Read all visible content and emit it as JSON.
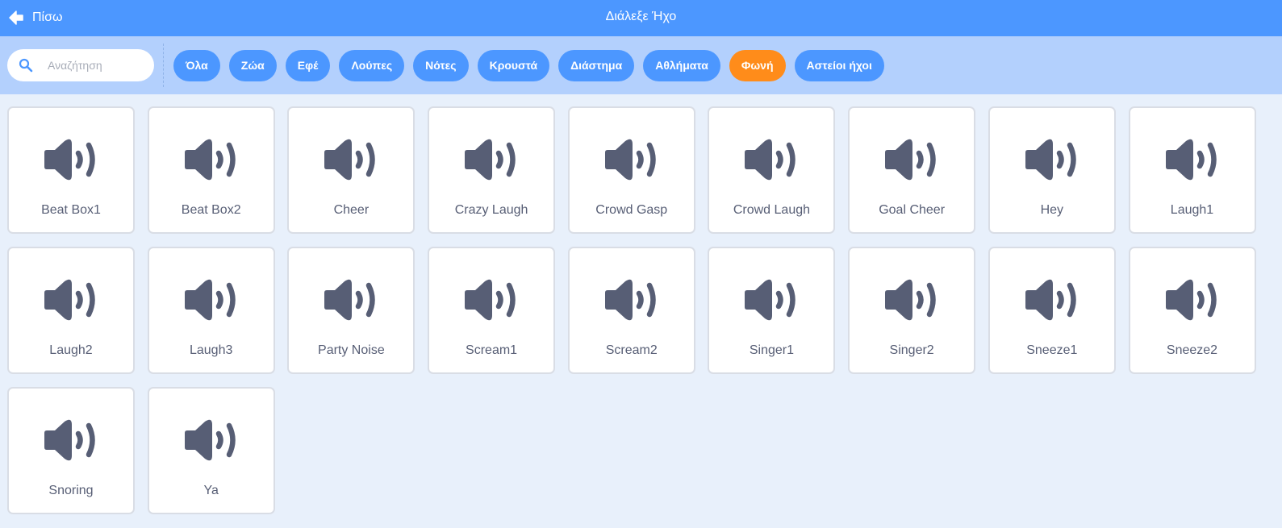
{
  "header": {
    "back_label": "Πίσω",
    "title": "Διάλεξε Ήχο",
    "back_icon": "arrow-left-icon"
  },
  "search": {
    "placeholder": "Αναζήτηση",
    "value": "",
    "icon": "search-icon"
  },
  "tags": [
    {
      "label": "Όλα",
      "active": false
    },
    {
      "label": "Ζώα",
      "active": false
    },
    {
      "label": "Εφέ",
      "active": false
    },
    {
      "label": "Λούπες",
      "active": false
    },
    {
      "label": "Νότες",
      "active": false
    },
    {
      "label": "Κρουστά",
      "active": false
    },
    {
      "label": "Διάστημα",
      "active": false
    },
    {
      "label": "Αθλήματα",
      "active": false
    },
    {
      "label": "Φωνή",
      "active": true
    },
    {
      "label": "Αστείοι ήχοι",
      "active": false
    }
  ],
  "sounds": [
    {
      "label": "Beat Box1",
      "icon": "speaker-icon"
    },
    {
      "label": "Beat Box2",
      "icon": "speaker-icon"
    },
    {
      "label": "Cheer",
      "icon": "speaker-icon"
    },
    {
      "label": "Crazy Laugh",
      "icon": "speaker-icon"
    },
    {
      "label": "Crowd Gasp",
      "icon": "speaker-icon"
    },
    {
      "label": "Crowd Laugh",
      "icon": "speaker-icon"
    },
    {
      "label": "Goal Cheer",
      "icon": "speaker-icon"
    },
    {
      "label": "Hey",
      "icon": "speaker-icon"
    },
    {
      "label": "Laugh1",
      "icon": "speaker-icon"
    },
    {
      "label": "Laugh2",
      "icon": "speaker-icon"
    },
    {
      "label": "Laugh3",
      "icon": "speaker-icon"
    },
    {
      "label": "Party Noise",
      "icon": "speaker-icon"
    },
    {
      "label": "Scream1",
      "icon": "speaker-icon"
    },
    {
      "label": "Scream2",
      "icon": "speaker-icon"
    },
    {
      "label": "Singer1",
      "icon": "speaker-icon"
    },
    {
      "label": "Singer2",
      "icon": "speaker-icon"
    },
    {
      "label": "Sneeze1",
      "icon": "speaker-icon"
    },
    {
      "label": "Sneeze2",
      "icon": "speaker-icon"
    },
    {
      "label": "Snoring",
      "icon": "speaker-icon"
    },
    {
      "label": "Ya",
      "icon": "speaker-icon"
    }
  ],
  "colors": {
    "header": "#4c97ff",
    "filter_bar": "#b3d0fd",
    "background": "#e8f0fb",
    "tag": "#4c97ff",
    "tag_active": "#ff8c1a",
    "icon": "#575e75"
  }
}
